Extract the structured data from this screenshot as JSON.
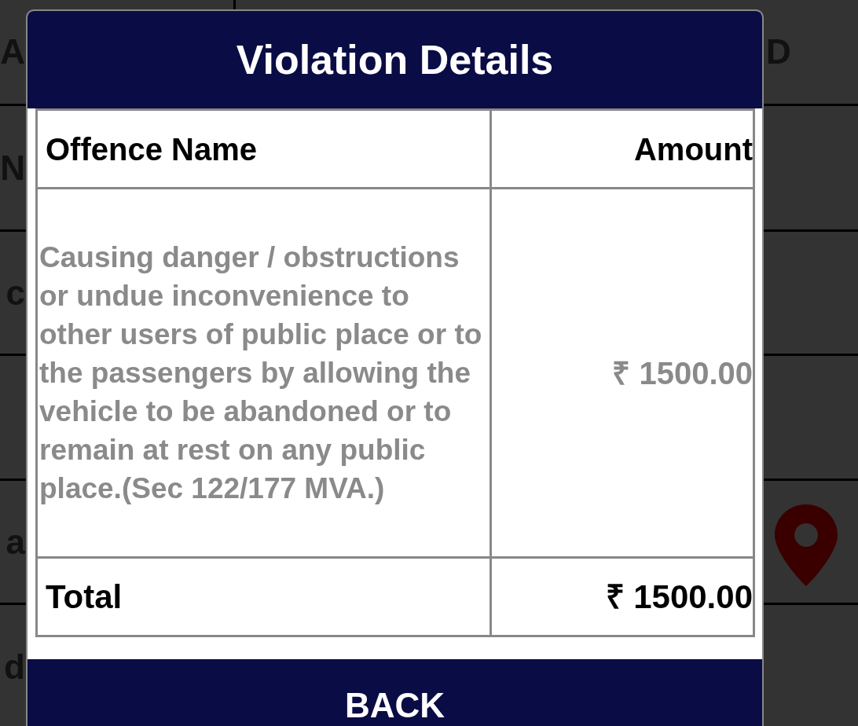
{
  "background_rows": [
    {
      "left": "A",
      "right": "D",
      "kind": "text"
    },
    {
      "left": "N",
      "kind": "text"
    },
    {
      "left": "c",
      "kind": "text"
    },
    {
      "kind": "empty"
    },
    {
      "left": "a",
      "kind": "location"
    },
    {
      "left": "d",
      "kind": "text"
    }
  ],
  "dialog": {
    "title": "Violation Details",
    "table": {
      "columns": [
        "Offence Name",
        "Amount"
      ],
      "rows": [
        {
          "offence": "Causing danger / obstructions or undue inconvenience to other users of public place or to the passengers by allowing the vehicle to be abandoned or to remain at rest on any public place.(Sec 122/177 MVA.)",
          "amount": "₹ 1500.00"
        }
      ],
      "total": {
        "label": "Total",
        "amount": "₹ 1500.00"
      }
    },
    "button": "BACK"
  }
}
